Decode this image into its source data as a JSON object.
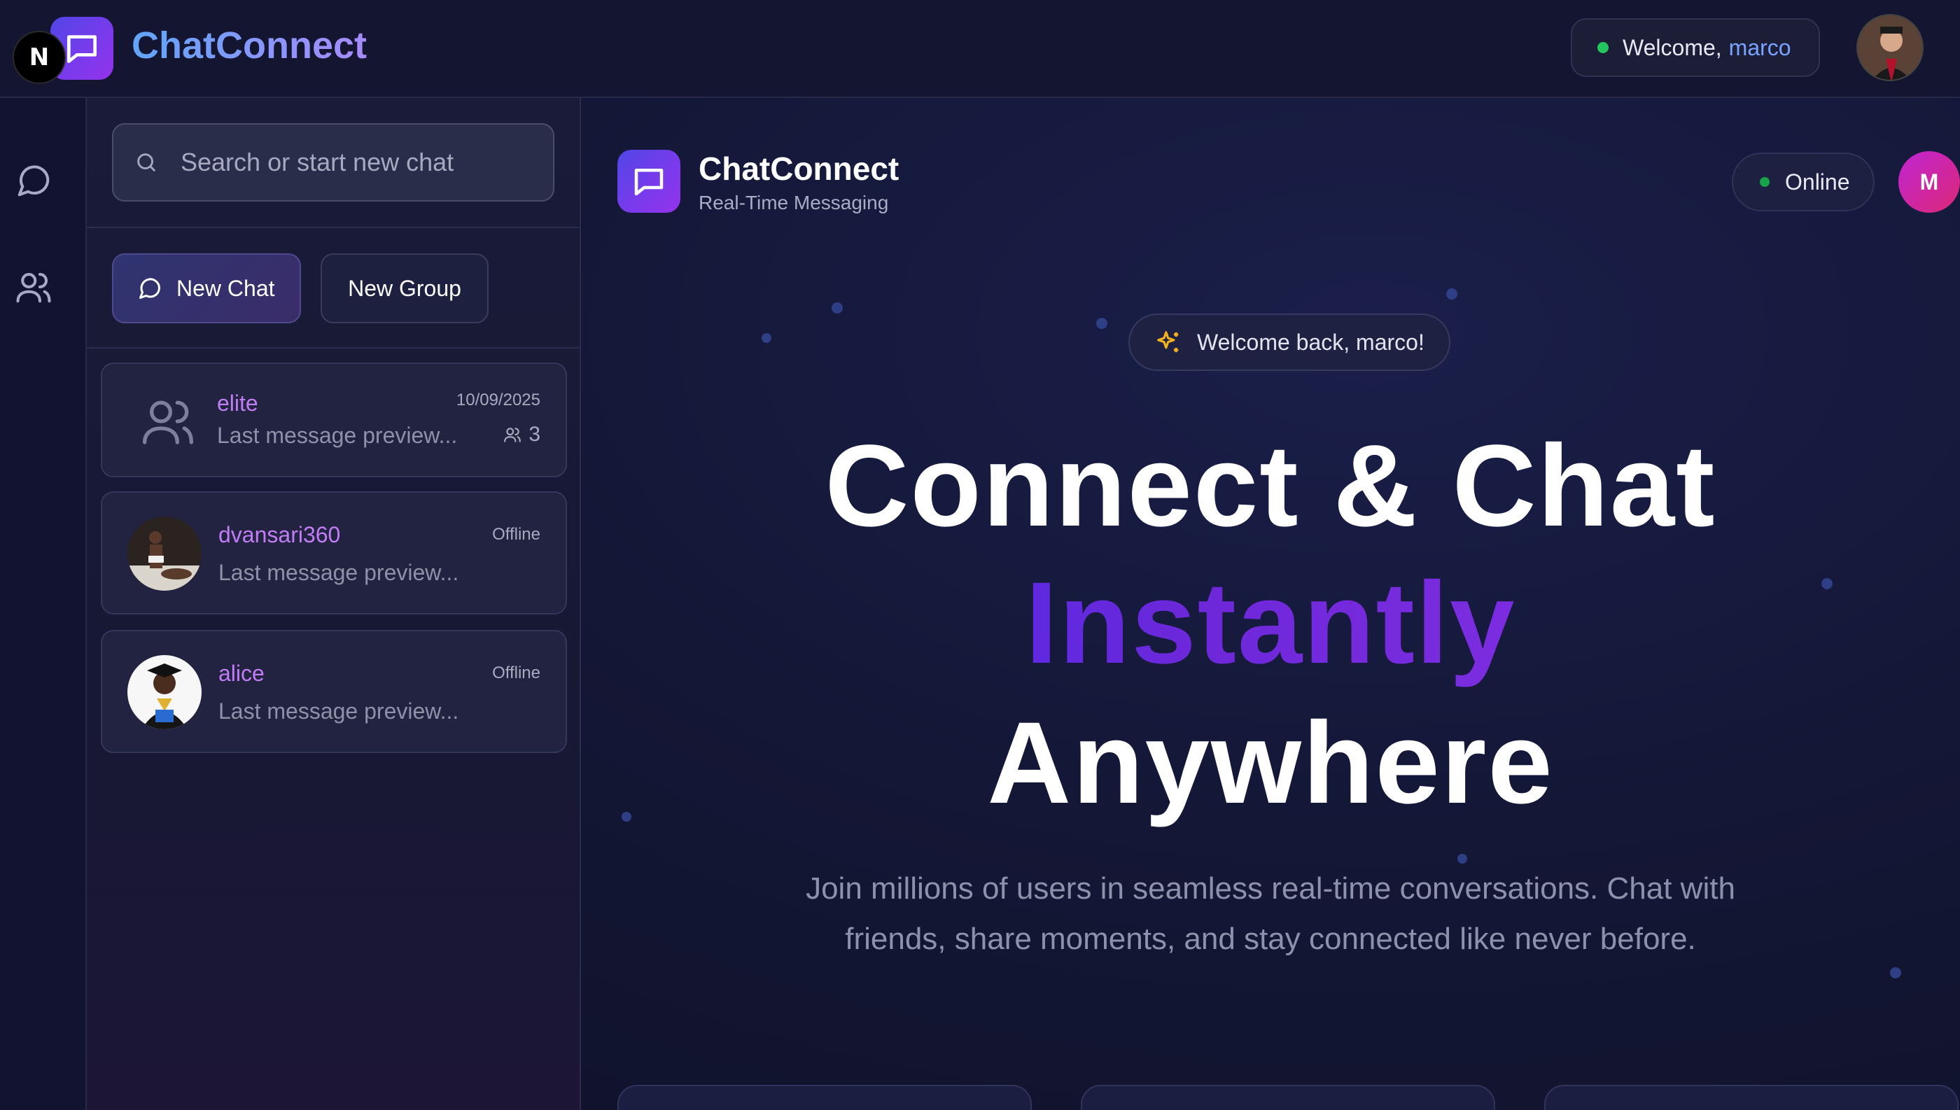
{
  "topbar": {
    "n_badge": "N",
    "brand": "ChatConnect",
    "welcome_prefix": "Welcome,",
    "welcome_user": "marco"
  },
  "sidebar_rail": {
    "items": [
      {
        "icon": "message-circle-icon"
      },
      {
        "icon": "users-icon"
      }
    ]
  },
  "chat_panel": {
    "search_placeholder": "Search or start new chat",
    "new_chat_label": "New Chat",
    "new_group_label": "New Group",
    "chats": [
      {
        "name": "elite",
        "time": "10/09/2025",
        "preview": "Last message preview...",
        "members": "3",
        "type": "group"
      },
      {
        "name": "dvansari360",
        "time": "Offline",
        "preview": "Last message preview...",
        "type": "direct"
      },
      {
        "name": "alice",
        "time": "Offline",
        "preview": "Last message preview...",
        "type": "direct"
      }
    ]
  },
  "main": {
    "title": "ChatConnect",
    "subtitle": "Real-Time Messaging",
    "status": "Online",
    "avatar_initial": "M",
    "welcome_back": "Welcome back, marco!",
    "headline_1": "Connect & Chat",
    "headline_2": "Instantly",
    "headline_3": "Anywhere",
    "paragraph_line_1": "Join millions of users in seamless real-time conversations. Chat with",
    "paragraph_line_2": "friends, share moments, and stay connected like never before."
  },
  "colors": {
    "accent": "#7c3aed",
    "online": "#22c55e",
    "name": "#c17cf6",
    "welcome_user": "#7aa2ff"
  }
}
